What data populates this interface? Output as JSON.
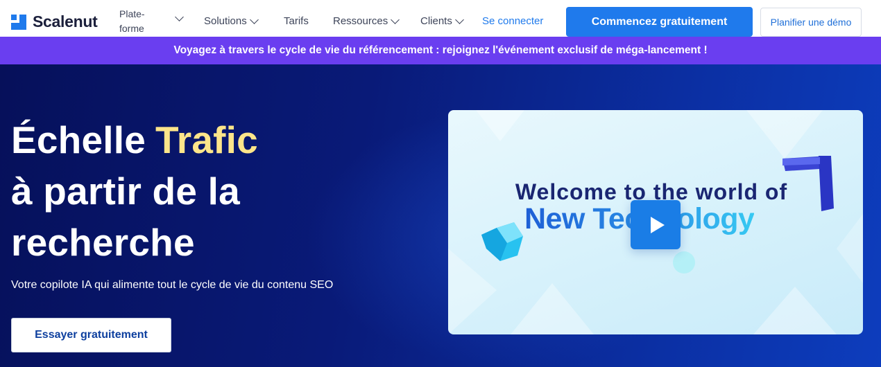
{
  "nav": {
    "brand": "Scalenut",
    "items": [
      {
        "label": "Plate-forme"
      },
      {
        "label": "Solutions"
      },
      {
        "label": "Tarifs"
      },
      {
        "label": "Ressources"
      },
      {
        "label": "Clients"
      }
    ],
    "signin_label": "Se connecter",
    "cta_label": "Commencez gratuitement",
    "demo_label": "Planifier une démo"
  },
  "banner": {
    "text": "Voyagez à travers le cycle de vie du référencement : rejoignez l'événement exclusif de méga-lancement !"
  },
  "hero": {
    "headline_1": "Échelle",
    "headline_highlight": "Trafic",
    "headline_2": "à partir de la",
    "headline_3": "recherche",
    "subtitle": "Votre copilote IA qui alimente tout le cycle de vie du contenu SEO",
    "cta_label": "Essayer gratuitement"
  },
  "video": {
    "line1": "Welcome to the world of",
    "line2": "New Technology"
  },
  "colors": {
    "primary": "#1f7aec",
    "banner": "#6a3ef0",
    "hero_bg": "#091a78",
    "highlight": "#fde58a"
  }
}
